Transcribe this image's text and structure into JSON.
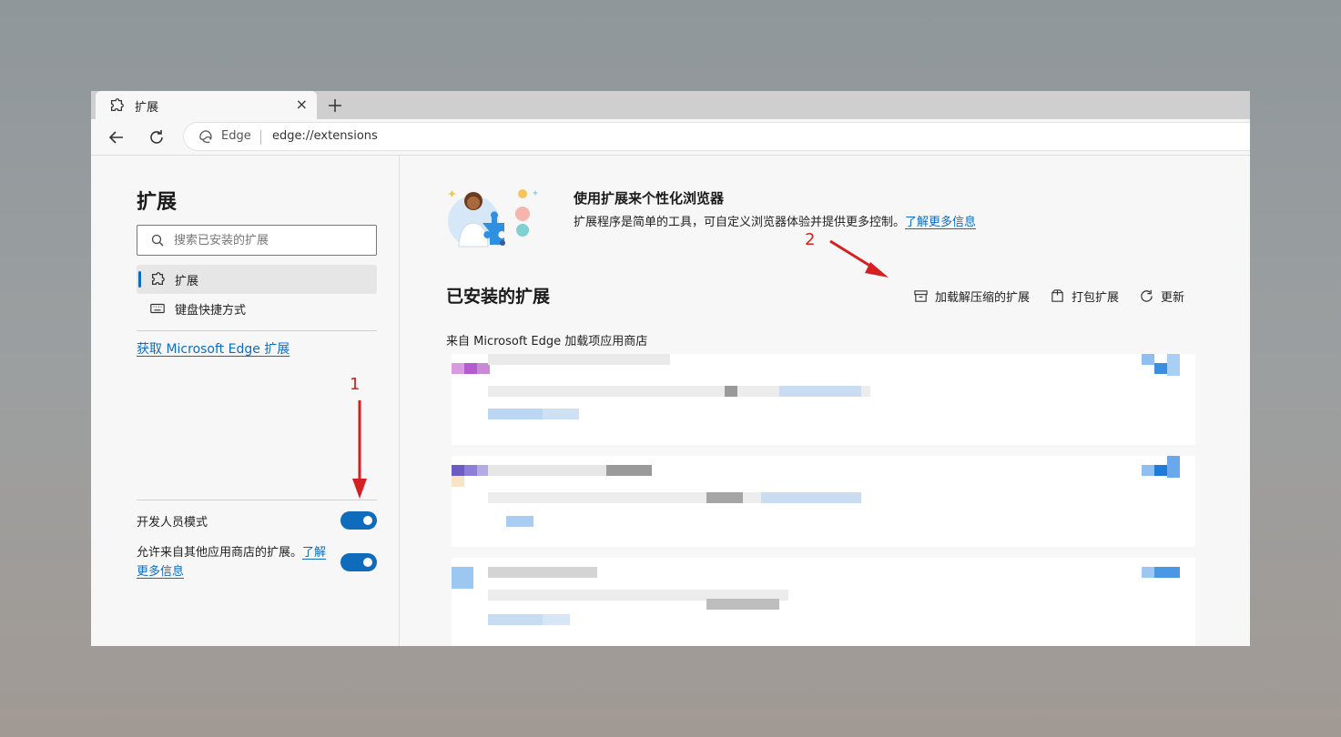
{
  "browser": {
    "tab": {
      "title": "扩展",
      "close_glyph": "×",
      "icon": "puzzle-icon"
    },
    "new_tab_icon": "plus-icon",
    "back_icon": "back-arrow-icon",
    "reload_icon": "reload-icon",
    "site_label": "Edge",
    "url": "edge://extensions"
  },
  "sidebar": {
    "title": "扩展",
    "search": {
      "placeholder": "搜索已安装的扩展",
      "value": ""
    },
    "items": [
      {
        "label": "扩展",
        "icon": "puzzle-icon",
        "active": true
      },
      {
        "label": "键盘快捷方式",
        "icon": "keyboard-icon",
        "active": false
      }
    ],
    "get_extensions_link": "获取 Microsoft Edge 扩展",
    "developer_mode": {
      "label": "开发人员模式",
      "on": true
    },
    "allow_other_stores": {
      "label": "允许来自其他应用商店的扩展。",
      "link": "了解更多信息",
      "on": true
    }
  },
  "main": {
    "hero": {
      "title": "使用扩展来个性化浏览器",
      "description": "扩展程序是简单的工具，可自定义浏览器体验并提供更多控制。",
      "link": "了解更多信息"
    },
    "installed_title": "已安装的扩展",
    "actions": [
      {
        "label": "加载解压缩的扩展",
        "icon": "load-unpacked-icon"
      },
      {
        "label": "打包扩展",
        "icon": "pack-icon"
      },
      {
        "label": "更新",
        "icon": "refresh-icon"
      }
    ],
    "source_label": "来自 Microsoft Edge 加载项应用商店"
  },
  "annotations": [
    {
      "number": "1"
    },
    {
      "number": "2"
    }
  ],
  "colors": {
    "accent": "#0f6cbd",
    "annotation": "#d42020"
  }
}
